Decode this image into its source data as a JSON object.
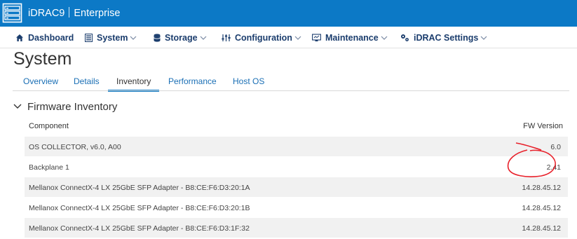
{
  "header": {
    "product": "iDRAC9",
    "edition": "Enterprise"
  },
  "nav": {
    "items": [
      {
        "label": "Dashboard",
        "icon": "home-icon"
      },
      {
        "label": "System",
        "icon": "server-icon"
      },
      {
        "label": "Storage",
        "icon": "storage-icon"
      },
      {
        "label": "Configuration",
        "icon": "sliders-icon"
      },
      {
        "label": "Maintenance",
        "icon": "monitor-icon"
      },
      {
        "label": "iDRAC Settings",
        "icon": "settings-icon"
      }
    ]
  },
  "page": {
    "title": "System"
  },
  "tabs": [
    {
      "label": "Overview",
      "active": false
    },
    {
      "label": "Details",
      "active": false
    },
    {
      "label": "Inventory",
      "active": true
    },
    {
      "label": "Performance",
      "active": false
    },
    {
      "label": "Host OS",
      "active": false
    }
  ],
  "section": {
    "title": "Firmware Inventory",
    "expanded": true
  },
  "table": {
    "columns": [
      "Component",
      "FW Version"
    ],
    "rows": [
      {
        "component": "OS COLLECTOR, v6.0, A00",
        "version": "6.0"
      },
      {
        "component": "Backplane 1",
        "version": "2.41"
      },
      {
        "component": "Mellanox ConnectX-4 LX 25GbE SFP Adapter - B8:CE:F6:D3:20:1A",
        "version": "14.28.45.12"
      },
      {
        "component": "Mellanox ConnectX-4 LX 25GbE SFP Adapter - B8:CE:F6:D3:20:1B",
        "version": "14.28.45.12"
      },
      {
        "component": "Mellanox ConnectX-4 LX 25GbE SFP Adapter - B8:CE:F6:D3:1F:32",
        "version": "14.28.45.12"
      }
    ]
  },
  "colors": {
    "header_bg": "#0c79c6",
    "nav_text": "#1b3d6d",
    "tab_link": "#1a6fb5",
    "row_alt": "#f1f1f1",
    "annotation": "#e8202a"
  }
}
